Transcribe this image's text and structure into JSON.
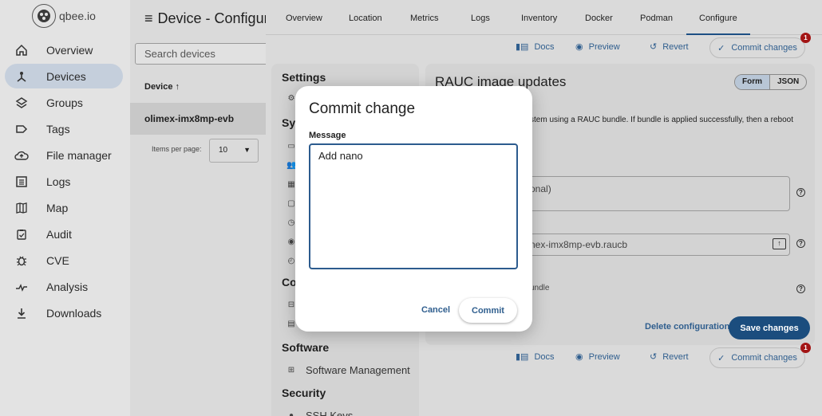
{
  "app": {
    "logo_text": "qbee.io"
  },
  "sidebar": {
    "items": [
      {
        "label": "Overview",
        "icon": "home-icon"
      },
      {
        "label": "Devices",
        "icon": "devices-icon",
        "active": true
      },
      {
        "label": "Groups",
        "icon": "layers-icon"
      },
      {
        "label": "Tags",
        "icon": "tag-icon"
      },
      {
        "label": "File manager",
        "icon": "cloud-upload-icon"
      },
      {
        "label": "Logs",
        "icon": "logs-icon"
      },
      {
        "label": "Map",
        "icon": "map-icon"
      },
      {
        "label": "Audit",
        "icon": "audit-icon"
      },
      {
        "label": "CVE",
        "icon": "bug-icon"
      },
      {
        "label": "Analysis",
        "icon": "analysis-icon"
      },
      {
        "label": "Downloads",
        "icon": "download-icon"
      }
    ]
  },
  "device_panel": {
    "title": "Device - Configure",
    "search_placeholder": "Search devices",
    "column_header": "Device",
    "sort_arrow": "↑",
    "rows": [
      "olimex-imx8mp-evb"
    ],
    "items_per_page_label": "Items per page:",
    "items_per_page_value": "10"
  },
  "tabs": [
    "Overview",
    "Location",
    "Metrics",
    "Logs",
    "Inventory",
    "Docker",
    "Podman",
    "Configure"
  ],
  "toolbar": {
    "docs": "Docs",
    "preview": "Preview",
    "revert": "Revert",
    "commit": "Commit changes",
    "badge_count": "1"
  },
  "settings": {
    "heading": "Settings",
    "sections": [
      {
        "label": "Sy"
      },
      {
        "label": "Co"
      },
      {
        "label": "Software",
        "items": [
          "Software Management"
        ]
      },
      {
        "label": "Security",
        "items": [
          "SSH Keys"
        ]
      }
    ]
  },
  "rauc": {
    "title": "RAUC image updates",
    "toggle": [
      "Form",
      "JSON"
    ],
    "description_fragment": "stem using a RAUC bundle. If bundle is applied successfully, then a reboot",
    "field1_fragment": "onal)",
    "field2_fragment": "nex-imx8mp-evb.raucb",
    "field3_fragment": "undle",
    "delete_label": "Delete configuration",
    "save_label": "Save changes"
  },
  "modal": {
    "title": "Commit change",
    "message_label": "Message",
    "message_value": "Add nano",
    "cancel_label": "Cancel",
    "commit_label": "Commit"
  },
  "colors": {
    "accent": "#1b4d7e",
    "link": "#2f5e8e",
    "badge": "#a31515",
    "active_nav": "#c5cfdc"
  }
}
